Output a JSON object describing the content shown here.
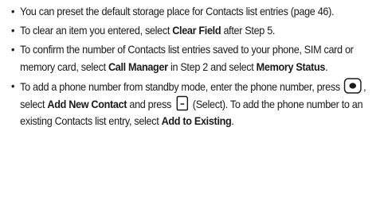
{
  "bullets": [
    {
      "t1": "You can preset the default storage place for Contacts list entries (page 46)."
    },
    {
      "t1": "To clear an item you entered, select ",
      "b1": "Clear Field",
      "t2": " after Step 5."
    },
    {
      "t1": "To confirm the number of Contacts list entries saved to your phone, SIM card or memory card, select ",
      "b1": "Call Manager",
      "t2": " in Step 2 and select ",
      "b2": "Memory Status",
      "t3": "."
    },
    {
      "t1": "To add a phone number from standby mode, enter the phone number, press ",
      "t2": ", select ",
      "b1": "Add New Contact",
      "t3": " and press ",
      "t4": " (Select). To add the phone number to an existing Contacts list entry, select ",
      "b2": "Add to Existing",
      "t5": "."
    }
  ],
  "icons": {
    "center_key": "center-select-key-icon",
    "soft_key": "left-soft-key-icon"
  }
}
